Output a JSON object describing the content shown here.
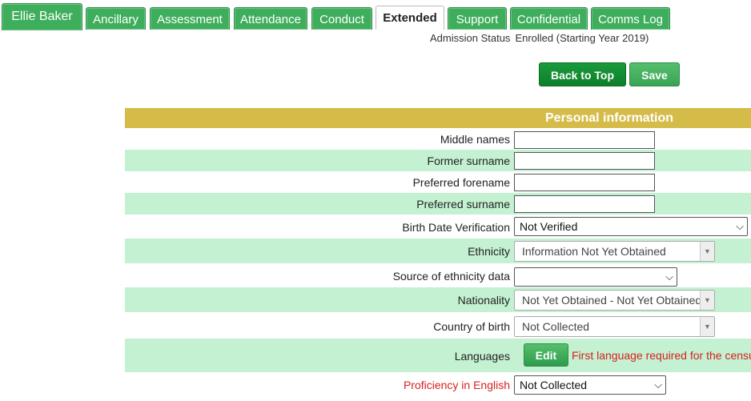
{
  "tabs": {
    "student_name": "Ellie Baker",
    "items": [
      "Ancillary",
      "Assessment",
      "Attendance",
      "Conduct",
      "Extended",
      "Support",
      "Confidential",
      "Comms Log"
    ],
    "active": "Extended"
  },
  "status": {
    "label": "Admission Status",
    "value": "Enrolled (Starting Year 2019)"
  },
  "toolbar": {
    "back_to_top": "Back to Top",
    "save": "Save"
  },
  "section": {
    "title": "Personal information"
  },
  "fields": {
    "middle_names": {
      "label": "Middle names",
      "value": ""
    },
    "former_surname": {
      "label": "Former surname",
      "value": ""
    },
    "preferred_forename": {
      "label": "Preferred forename",
      "value": ""
    },
    "preferred_surname": {
      "label": "Preferred surname",
      "value": ""
    },
    "birth_date_verification": {
      "label": "Birth Date Verification",
      "value": "Not Verified"
    },
    "ethnicity": {
      "label": "Ethnicity",
      "value": "Information Not Yet Obtained"
    },
    "ethnicity_source": {
      "label": "Source of ethnicity data",
      "value": ""
    },
    "nationality": {
      "label": "Nationality",
      "value": "Not Yet Obtained - Not Yet Obtained"
    },
    "country_of_birth": {
      "label": "Country of birth",
      "value": "Not Collected"
    },
    "languages": {
      "label": "Languages",
      "button": "Edit",
      "warning": "First language required for the census."
    },
    "proficiency_english": {
      "label": "Proficiency in English",
      "value": "Not Collected"
    }
  },
  "colors": {
    "tab_green": "#3fae5c",
    "header_gold": "#d5bb48",
    "row_alt": "#c3f1d2",
    "required_red": "#d92020"
  }
}
